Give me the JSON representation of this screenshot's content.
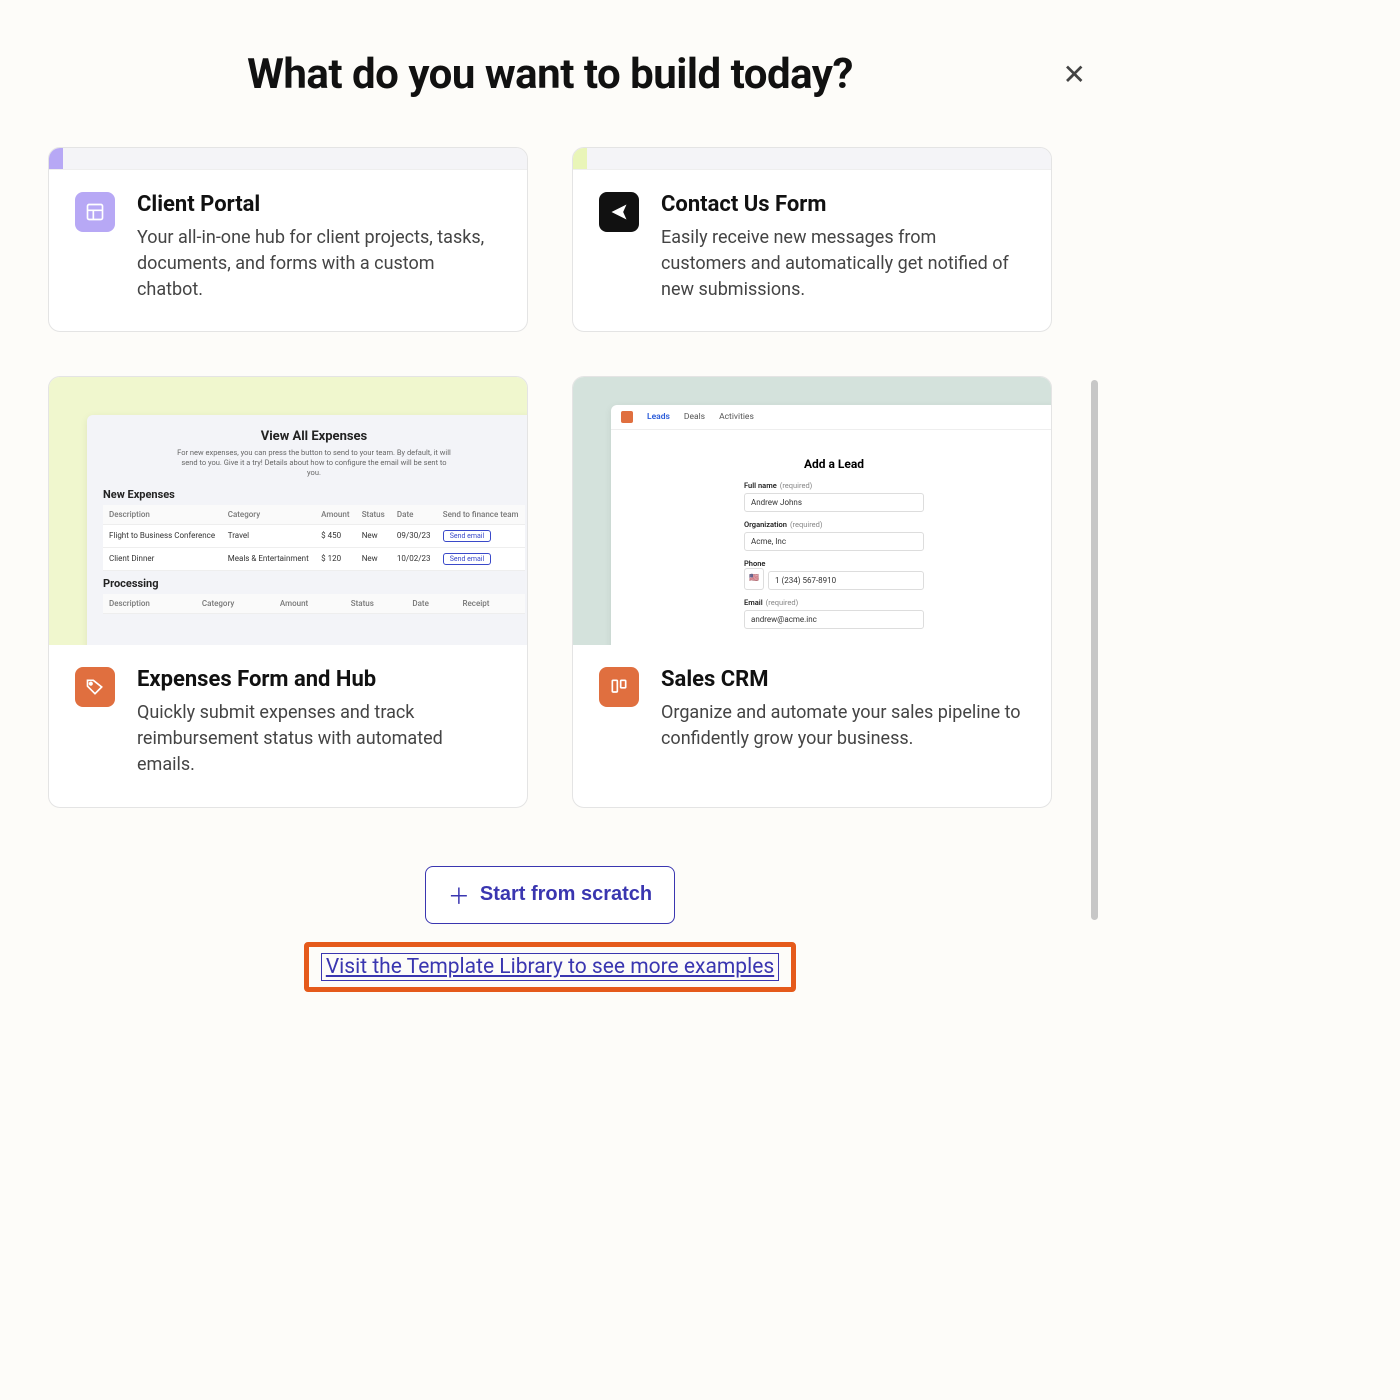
{
  "header": {
    "title": "What do you want to build today?"
  },
  "cards": {
    "client_portal": {
      "title": "Client Portal",
      "desc": "Your all-in-one hub for client projects, tasks, documents, and forms with a custom chatbot."
    },
    "contact_us": {
      "title": "Contact Us Form",
      "desc": "Easily receive new messages from customers and automatically get notified of new submissions."
    },
    "expenses": {
      "title": "Expenses Form and Hub",
      "desc": "Quickly submit expenses and track reimbursement status with automated emails.",
      "preview": {
        "heading": "View All Expenses",
        "sub": "For new expenses, you can press the button to send to your team. By default, it will send to you. Give it a try! Details about how to configure the email will be sent to you.",
        "section1": "New Expenses",
        "section2": "Processing",
        "columns": [
          "Description",
          "Category",
          "Amount",
          "Status",
          "Date",
          "Send to finance team"
        ],
        "columns2": [
          "Description",
          "Category",
          "Amount",
          "Status",
          "Date",
          "Receipt"
        ],
        "rows": [
          {
            "desc": "Flight to Business Conference",
            "cat": "Travel",
            "amt": "$ 450",
            "status": "New",
            "date": "09/30/23",
            "btn": "Send email"
          },
          {
            "desc": "Client Dinner",
            "cat": "Meals & Entertainment",
            "amt": "$ 120",
            "status": "New",
            "date": "10/02/23",
            "btn": "Send email"
          }
        ]
      }
    },
    "sales_crm": {
      "title": "Sales CRM",
      "desc": "Organize and automate your sales pipeline to confidently grow your business.",
      "preview": {
        "tabs": [
          "Leads",
          "Deals",
          "Activities"
        ],
        "form_title": "Add a Lead",
        "fields": {
          "fullname_label": "Full name",
          "fullname_req": "(required)",
          "fullname_val": "Andrew Johns",
          "org_label": "Organization",
          "org_req": "(required)",
          "org_val": "Acme, Inc",
          "phone_label": "Phone",
          "phone_val": "1 (234) 567-8910",
          "email_label": "Email",
          "email_req": "(required)",
          "email_val": "andrew@acme.inc"
        }
      }
    }
  },
  "footer": {
    "scratch_label": "Start from scratch",
    "template_link": "Visit the Template Library to see more examples"
  }
}
